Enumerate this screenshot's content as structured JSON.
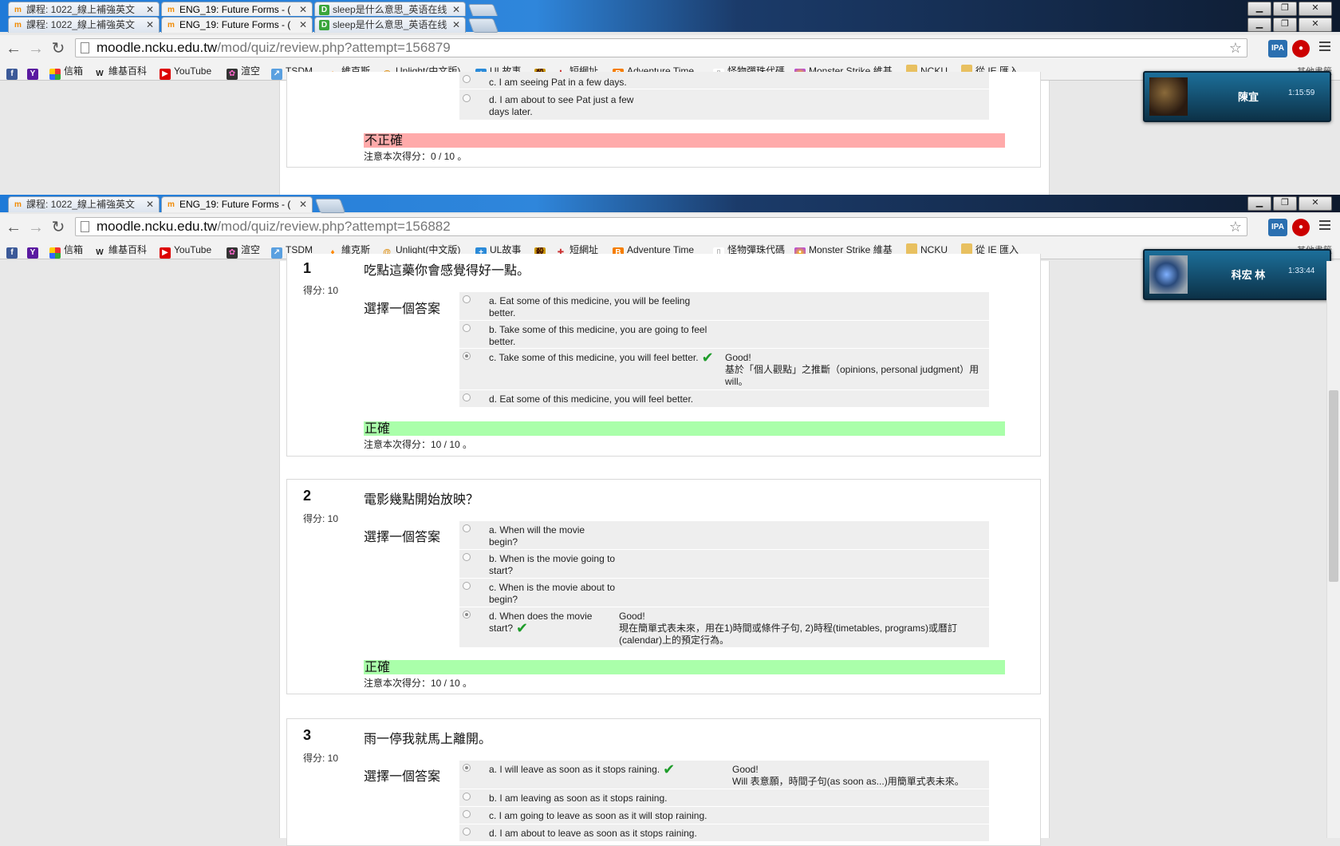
{
  "window1": {
    "tabs": [
      {
        "label": "課程: 1022_線上補強英文"
      },
      {
        "label": "ENG_19: Future Forms - ("
      },
      {
        "label": "sleep是什么意思_英语在线"
      }
    ],
    "url_host": "moodle.ncku.edu.tw",
    "url_path": "/mod/quiz/review.php?attempt=156879"
  },
  "window2": {
    "tabs": [
      {
        "label": "課程: 1022_線上補強英文"
      },
      {
        "label": "ENG_19: Future Forms - ("
      }
    ],
    "url_host": "moodle.ncku.edu.tw",
    "url_path": "/mod/quiz/review.php?attempt=156882"
  },
  "extensions": {
    "ipa": "IPA"
  },
  "bookmarks": [
    {
      "label": "",
      "icon": "facebook-icon"
    },
    {
      "label": "",
      "icon": "yahoo-icon"
    },
    {
      "label": "信箱",
      "icon": "apps-icon"
    },
    {
      "label": "維基百科",
      "icon": "wikipedia-icon"
    },
    {
      "label": "YouTube",
      "icon": "youtube-icon"
    },
    {
      "label": "渲空",
      "icon": "flower-icon"
    },
    {
      "label": "TSDM",
      "icon": "tsdm-icon"
    },
    {
      "label": "維克斯",
      "icon": "fire-icon"
    },
    {
      "label": "Unlight(中文版)",
      "icon": "at-icon"
    },
    {
      "label": "UL故事",
      "icon": "plus-icon"
    },
    {
      "label": "",
      "icon": "kanji-icon"
    },
    {
      "label": "短網址",
      "icon": "puzzle-icon"
    },
    {
      "label": "Adventure Time",
      "icon": "blogger-icon"
    },
    {
      "label": "怪物彈珠代碼",
      "icon": "page-icon"
    },
    {
      "label": "Monster Strike 維基",
      "icon": "monster-icon"
    },
    {
      "label": "NCKU",
      "icon": "folder-icon"
    },
    {
      "label": "從 IE 匯入",
      "icon": "folder-icon"
    }
  ],
  "bookmarks_overflow": "其他書籤",
  "chats": [
    {
      "name": "陳宜",
      "time": "1:15:59"
    },
    {
      "name": "科宏 林",
      "time": "1:33:44"
    }
  ],
  "window1_content": {
    "answers": [
      {
        "text": "c. I am seeing Pat in a few days."
      },
      {
        "text": "d. I am about to see Pat just a few days later."
      }
    ],
    "status": "不正確",
    "mark": "注意本次得分：0 / 10 。"
  },
  "questions": [
    {
      "no": "1",
      "score": "得分: 10",
      "text": "吃點這藥你會感覺得好一點。",
      "choose": "選擇一個答案",
      "answers": [
        {
          "text": "a. Eat some of this medicine, you will be feeling better."
        },
        {
          "text": "b. Take some of this medicine, you are going to feel better."
        },
        {
          "text": "c. Take some of this medicine, you will feel better.",
          "feedback_title": "Good!",
          "feedback": "基於「個人觀點」之推斷（opinions, personal judgment）用 will。"
        },
        {
          "text": "d. Eat some of this medicine, you will feel better."
        }
      ],
      "status": "正確",
      "mark": "注意本次得分：10 / 10 。"
    },
    {
      "no": "2",
      "score": "得分: 10",
      "text": "電影幾點開始放映？",
      "choose": "選擇一個答案",
      "answers": [
        {
          "text": "a. When will the movie begin?"
        },
        {
          "text": "b. When is the movie going to start?"
        },
        {
          "text": "c. When is the movie about to begin?"
        },
        {
          "text": "d. When does the movie start?",
          "feedback_title": "Good!",
          "feedback": "現在簡單式表未來，用在1)時間或條件子句, 2)時程(timetables, programs)或曆訂(calendar)上的預定行為。"
        }
      ],
      "status": "正確",
      "mark": "注意本次得分：10 / 10 。"
    },
    {
      "no": "3",
      "score": "得分: 10",
      "text": "雨一停我就馬上離開。",
      "choose": "選擇一個答案",
      "answers": [
        {
          "text": "a. I will leave as soon as it stops raining.",
          "feedback_title": "Good!",
          "feedback": "Will 表意願，時間子句(as soon as...)用簡單式表未來。"
        },
        {
          "text": "b. I am leaving as soon as it stops raining."
        },
        {
          "text": "c. I am going to leave as soon as it will stop raining."
        },
        {
          "text": "d. I am about to leave as soon as it stops raining."
        }
      ]
    }
  ],
  "colors": {
    "correct_bg": "#aaffaa",
    "incorrect_bg": "#ffaaaa",
    "check": "#1e9c2a",
    "tab_strip": "#1f7ad8"
  }
}
